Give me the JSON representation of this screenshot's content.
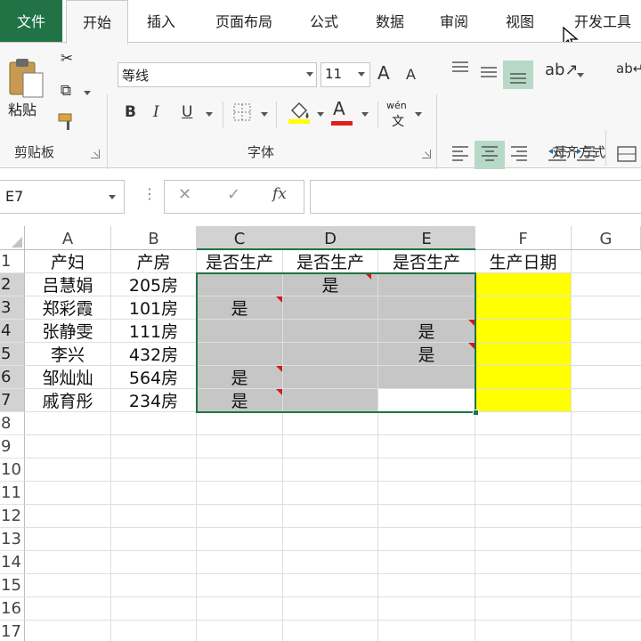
{
  "tabs": [
    "文件",
    "开始",
    "插入",
    "页面布局",
    "公式",
    "数据",
    "审阅",
    "视图",
    "开发工具"
  ],
  "ribbon": {
    "clipboard": {
      "paste_label": "粘贴",
      "group_label": "剪贴板"
    },
    "font": {
      "name": "等线",
      "size": "11",
      "group_label": "字体",
      "bold": "B",
      "italic": "I",
      "underline": "U",
      "grow": "A",
      "shrink": "A",
      "font_color": "A",
      "phonetic_top": "wén",
      "phonetic_bottom": "文"
    },
    "alignment": {
      "group_label": "对齐方式"
    }
  },
  "formula_bar": {
    "name_box": "E7",
    "cancel": "✕",
    "enter": "✓",
    "fx": "fx",
    "value": ""
  },
  "sheet": {
    "columns": [
      "A",
      "B",
      "C",
      "D",
      "E",
      "F",
      "G"
    ],
    "rows": [
      "1",
      "2",
      "3",
      "4",
      "5",
      "6",
      "7",
      "8",
      "9",
      "10",
      "11",
      "12",
      "13",
      "14",
      "15",
      "16",
      "17"
    ],
    "headers": [
      "产妇",
      "产房",
      "是否生产",
      "是否生产",
      "是否生产",
      "生产日期"
    ],
    "data": [
      {
        "mother": "吕慧娟",
        "room": "205房",
        "c": "",
        "d": "是",
        "e": "",
        "f": ""
      },
      {
        "mother": "郑彩霞",
        "room": "101房",
        "c": "是",
        "d": "",
        "e": "",
        "f": ""
      },
      {
        "mother": "张静雯",
        "room": "111房",
        "c": "",
        "d": "",
        "e": "是",
        "f": ""
      },
      {
        "mother": "李兴",
        "room": "432房",
        "c": "",
        "d": "",
        "e": "是",
        "f": ""
      },
      {
        "mother": "邹灿灿",
        "room": "564房",
        "c": "是",
        "d": "",
        "e": "",
        "f": ""
      },
      {
        "mother": "戚育彤",
        "room": "234房",
        "c": "是",
        "d": "",
        "e": "",
        "f": ""
      }
    ]
  },
  "colors": {
    "file_tab": "#217346",
    "fill_highlight": "#ffff00",
    "selection_fill": "#c6c6c6",
    "selection_border": "#217346",
    "comment_marker": "#d01a1a",
    "font_color": "#e02020"
  }
}
